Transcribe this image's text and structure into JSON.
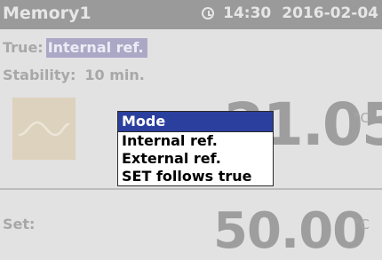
{
  "header": {
    "title": "Memory1",
    "time": "14:30",
    "date": "2016-02-04",
    "clock_icon": "clock-icon"
  },
  "status": {
    "true_label": "True:",
    "true_value": "Internal ref.",
    "stability_label": "Stability:",
    "stability_value": "10 min."
  },
  "reading": {
    "temperature": "21.05",
    "unit": "°C",
    "wave_icon": "wave-icon"
  },
  "setpoint": {
    "label": "Set:",
    "value": "50.00",
    "unit": "°C"
  },
  "menu": {
    "title": "Mode",
    "items": [
      "Internal ref.",
      "External ref.",
      "SET follows true"
    ]
  },
  "colors": {
    "header_bg": "#9a9a9a",
    "menu_title_bg": "#2a3f9e",
    "highlight_bg": "#aba8c6",
    "wave_box_bg": "#ddd2bd"
  }
}
